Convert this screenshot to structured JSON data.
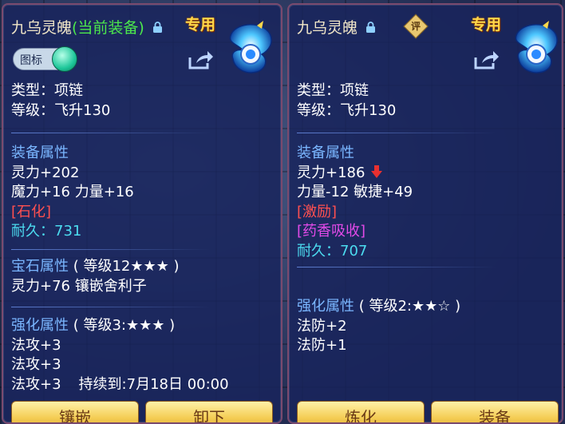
{
  "left_panel": {
    "item_name": "九乌灵魄",
    "equipped_tag": "(当前装备)",
    "special_tag": "专用",
    "icon_toggle_label": "图标",
    "type_line": "类型：项链",
    "level_line": "等级：飞升130",
    "equip_attr_title": "装备属性",
    "attr_lines": [
      "灵力+202",
      "魔力+16 力量+16"
    ],
    "stone_tag": "[石化]",
    "durability_line": "耐久：731",
    "gem_title": "宝石属性",
    "gem_note": "( 等级12★★★ )",
    "gem_line": "灵力+76 镶嵌舍利子",
    "enhance_title": "强化属性",
    "enhance_note": "( 等级3:★★★ )",
    "enhance_lines": [
      "法攻+3",
      "法攻+3"
    ],
    "enhance_last": "法攻+3",
    "enhance_duration": "持续到:7月18日 00:00",
    "buttons": [
      "镶嵌",
      "卸下"
    ]
  },
  "right_panel": {
    "item_name": "九乌灵魄",
    "appraise_label": "评",
    "special_tag": "专用",
    "type_line": "类型：项链",
    "level_line": "等级：飞升130",
    "equip_attr_title": "装备属性",
    "attr_line_1": "灵力+186",
    "attr_line_2": "力量-12 敏捷+49",
    "tag_1": "[激励]",
    "tag_2": "[药香吸收]",
    "durability_line": "耐久：707",
    "enhance_title": "强化属性",
    "enhance_note": "( 等级2:★★☆ )",
    "enhance_lines": [
      "法防+2",
      "法防+1"
    ],
    "buttons": [
      "炼化",
      "装备"
    ]
  },
  "colors": {
    "title": "#f2e7c8",
    "equipped": "#4ce84c",
    "special": "#ffd84a",
    "section": "#7ab6ff",
    "durability": "#4cdcf0",
    "stone": "#ff5050",
    "purple": "#e24ae8"
  },
  "icons": [
    "lock-icon",
    "share-icon",
    "item-icon",
    "appraise-icon",
    "down-arrow-icon"
  ]
}
